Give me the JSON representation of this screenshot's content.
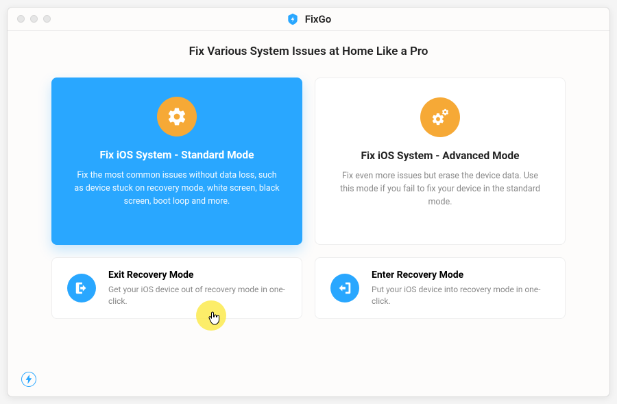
{
  "app": {
    "name": "FixGo"
  },
  "headline": "Fix Various System Issues at Home Like a Pro",
  "cards": {
    "standard": {
      "title": "Fix iOS System - Standard Mode",
      "desc": "Fix the most common issues without data loss, such as device stuck on recovery mode, white screen, black screen, boot loop and more."
    },
    "advanced": {
      "title": "Fix iOS System - Advanced Mode",
      "desc": "Fix even more issues but erase the device data. Use this mode if you fail to fix your device in the standard mode."
    },
    "exit": {
      "title": "Exit Recovery Mode",
      "desc": "Get your iOS device out of recovery mode in one-click."
    },
    "enter": {
      "title": "Enter Recovery Mode",
      "desc": "Put your iOS device into recovery mode in one-click."
    }
  }
}
